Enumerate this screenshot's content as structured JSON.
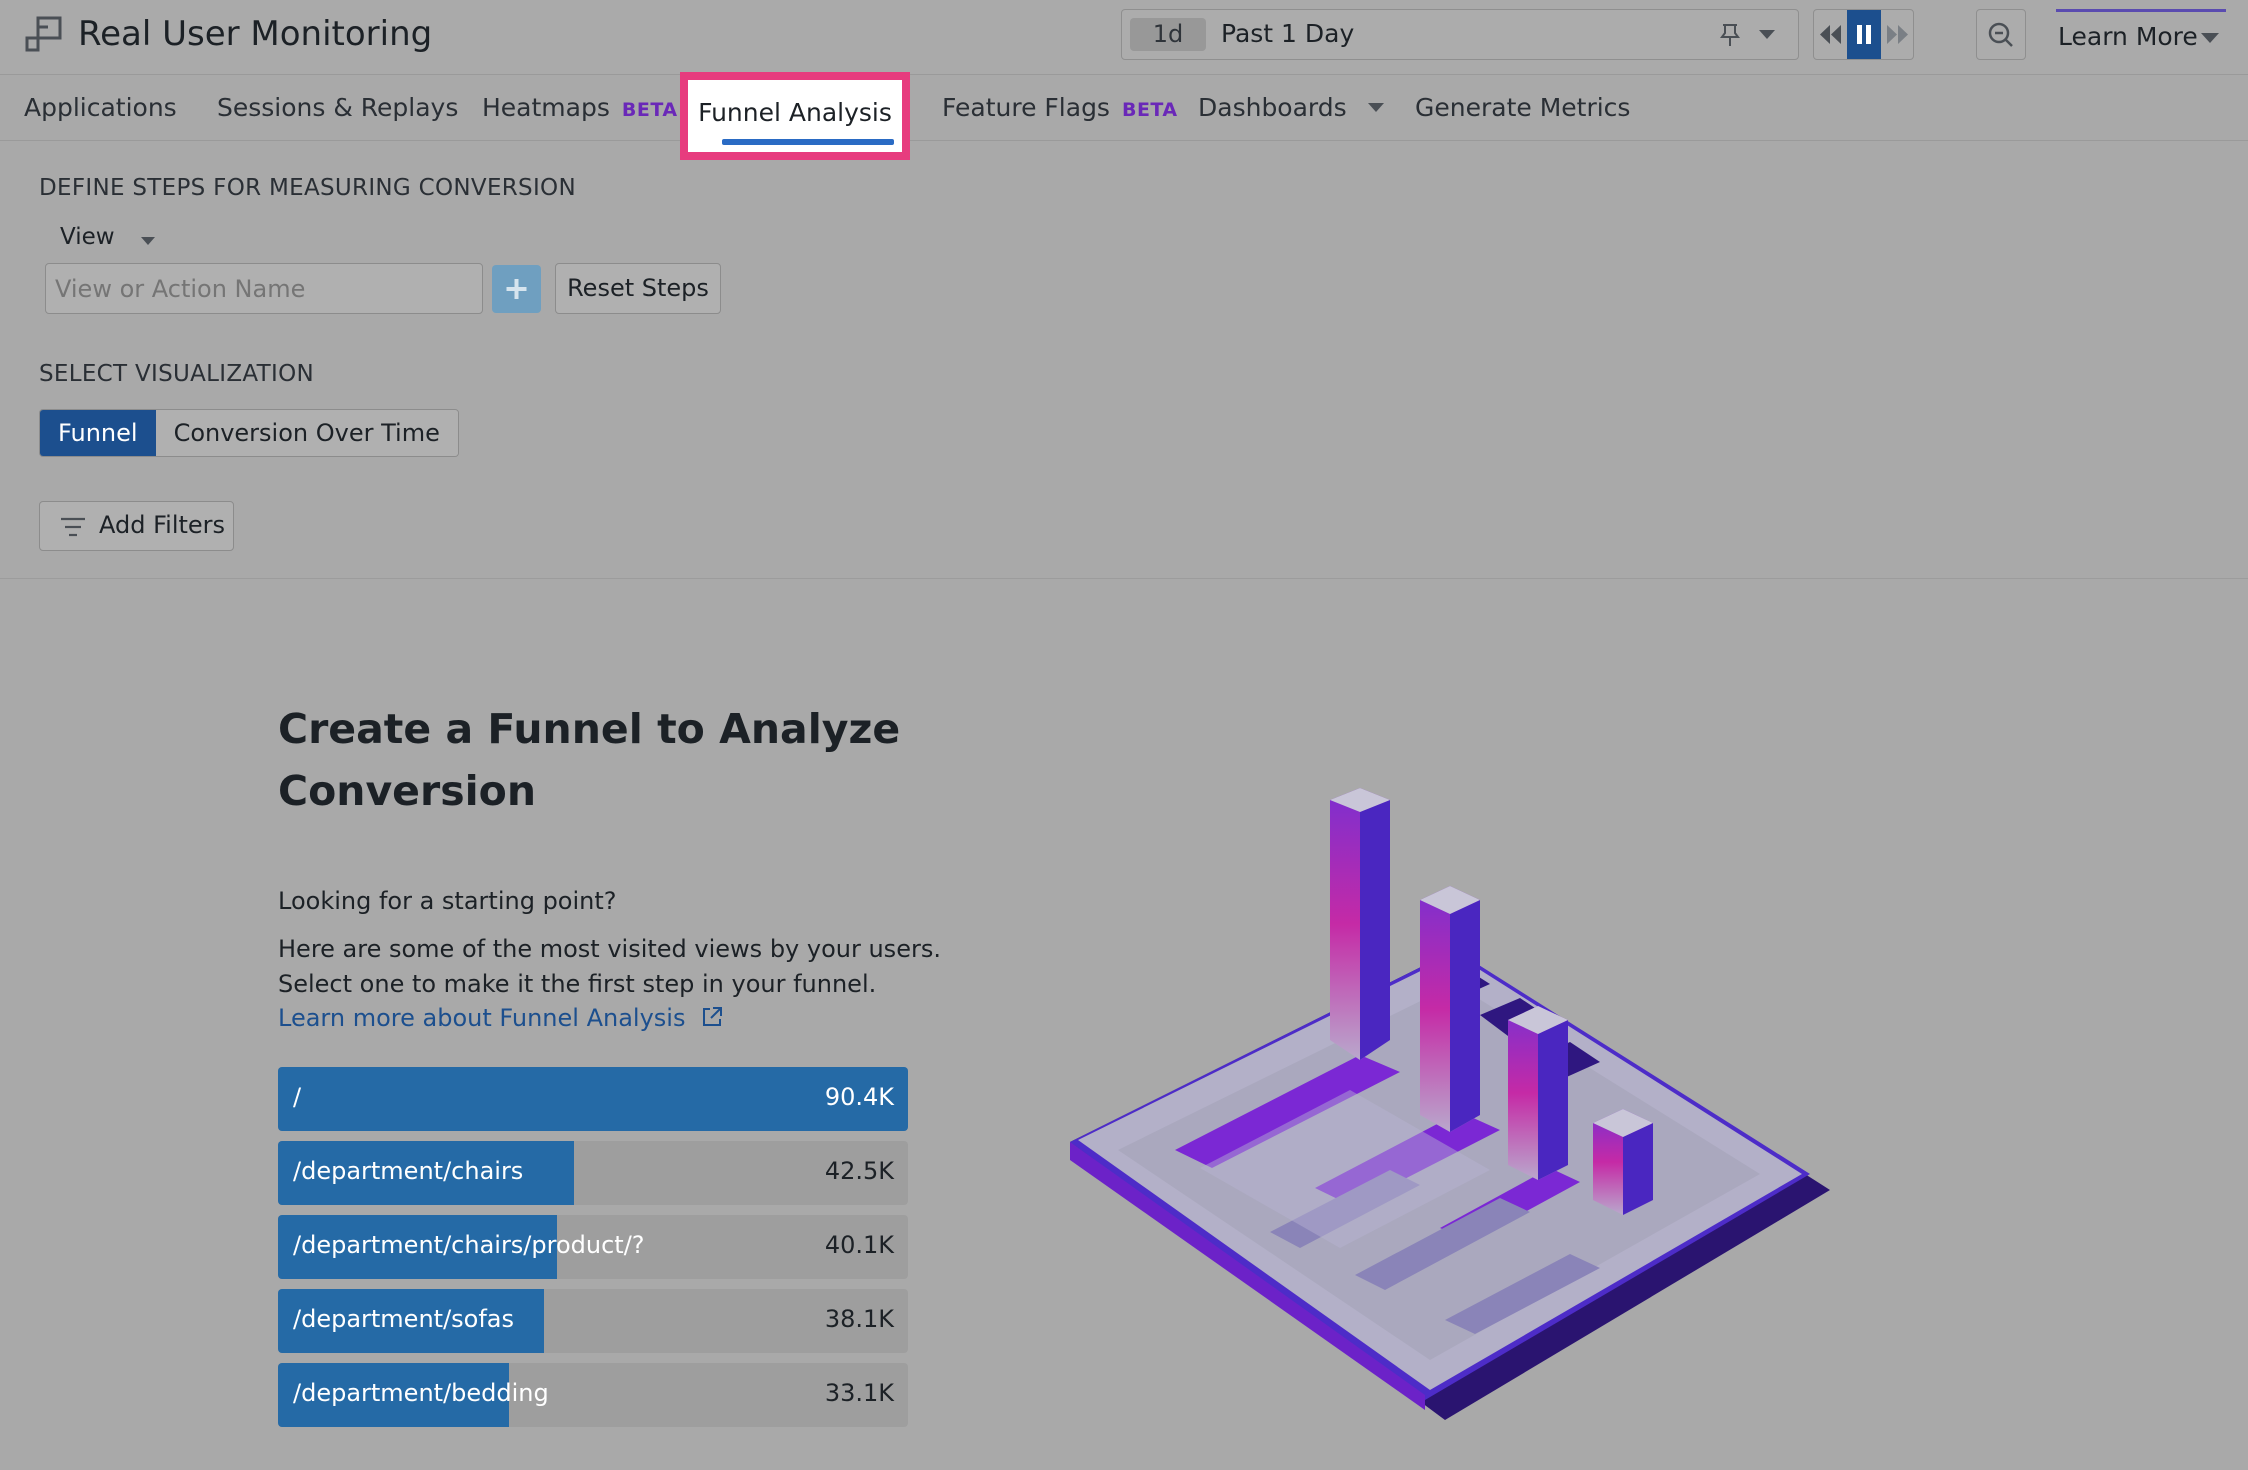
{
  "header": {
    "title": "Real User Monitoring",
    "time_chip": "1d",
    "time_label": "Past 1 Day",
    "learn_more": "Learn More"
  },
  "nav": {
    "items": [
      {
        "label": "Applications"
      },
      {
        "label": "Sessions & Replays"
      },
      {
        "label": "Heatmaps",
        "badge": "BETA"
      },
      {
        "label": "Funnel Analysis",
        "active": true
      },
      {
        "label": "Feature Flags",
        "badge": "BETA"
      },
      {
        "label": "Dashboards"
      },
      {
        "label": "Generate Metrics"
      }
    ]
  },
  "steps": {
    "heading": "DEFINE STEPS FOR MEASURING CONVERSION",
    "type_select": "View",
    "input_placeholder": "View or Action Name",
    "reset_label": "Reset Steps"
  },
  "visualization": {
    "heading": "SELECT VISUALIZATION",
    "options": [
      "Funnel",
      "Conversion Over Time"
    ],
    "selected": "Funnel"
  },
  "filters": {
    "label": "Add Filters"
  },
  "empty_state": {
    "title_line1": "Create a Funnel to Analyze",
    "title_line2": "Conversion",
    "intro": "Looking for a starting point?",
    "desc_line1": "Here are some of the most visited views by your users.",
    "desc_line2": "Select one to make it the first step in your funnel.",
    "link": "Learn more about Funnel Analysis"
  },
  "top_views": [
    {
      "path": "/",
      "count": "90.4K",
      "value": 90.4
    },
    {
      "path": "/department/chairs",
      "count": "42.5K",
      "value": 42.5
    },
    {
      "path": "/department/chairs/product/?",
      "count": "40.1K",
      "value": 40.1
    },
    {
      "path": "/department/sofas",
      "count": "38.1K",
      "value": 38.1
    },
    {
      "path": "/department/bedding",
      "count": "33.1K",
      "value": 33.1
    }
  ],
  "colors": {
    "accent": "#1c4f8e",
    "bar": "#256aa6",
    "highlight": "#e73c7e",
    "beta": "#6a28b8"
  }
}
